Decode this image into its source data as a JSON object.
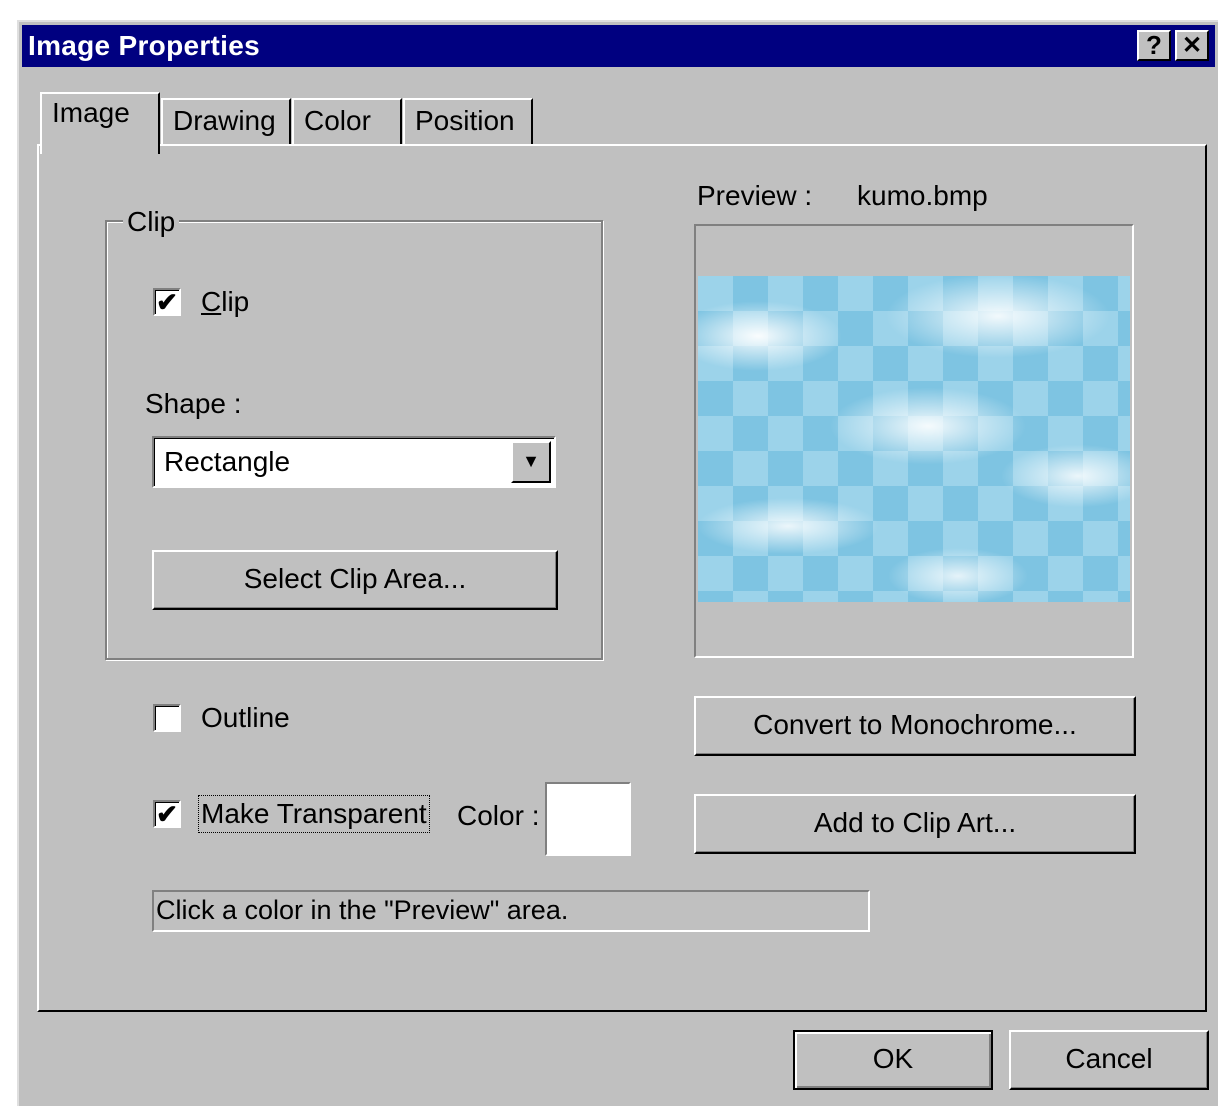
{
  "window": {
    "title": "Image Properties",
    "help_button": "?",
    "close_button": "✕"
  },
  "tabs": [
    {
      "label": "Image",
      "active": true
    },
    {
      "label": "Drawing",
      "active": false
    },
    {
      "label": "Color",
      "active": false
    },
    {
      "label": "Position",
      "active": false
    }
  ],
  "clip_group": {
    "legend": "Clip",
    "clip_checkbox": {
      "label": "Clip",
      "checked": true
    },
    "shape_label": "Shape :",
    "shape_value": "Rectangle",
    "select_clip_area": "Select Clip Area..."
  },
  "preview": {
    "label": "Preview :",
    "filename": "kumo.bmp"
  },
  "outline": {
    "label": "Outline",
    "checked": false
  },
  "make_transparent": {
    "label": "Make Transparent",
    "checked": true
  },
  "color_label": "Color :",
  "swatch_color": "#ffffff",
  "status_text": "Click a color in the \"Preview\" area.",
  "buttons": {
    "convert": "Convert to Monochrome...",
    "add_clip_art": "Add to Clip Art...",
    "ok": "OK",
    "cancel": "Cancel"
  },
  "colors": {
    "titlebar": "#000080",
    "face": "#c0c0c0"
  }
}
